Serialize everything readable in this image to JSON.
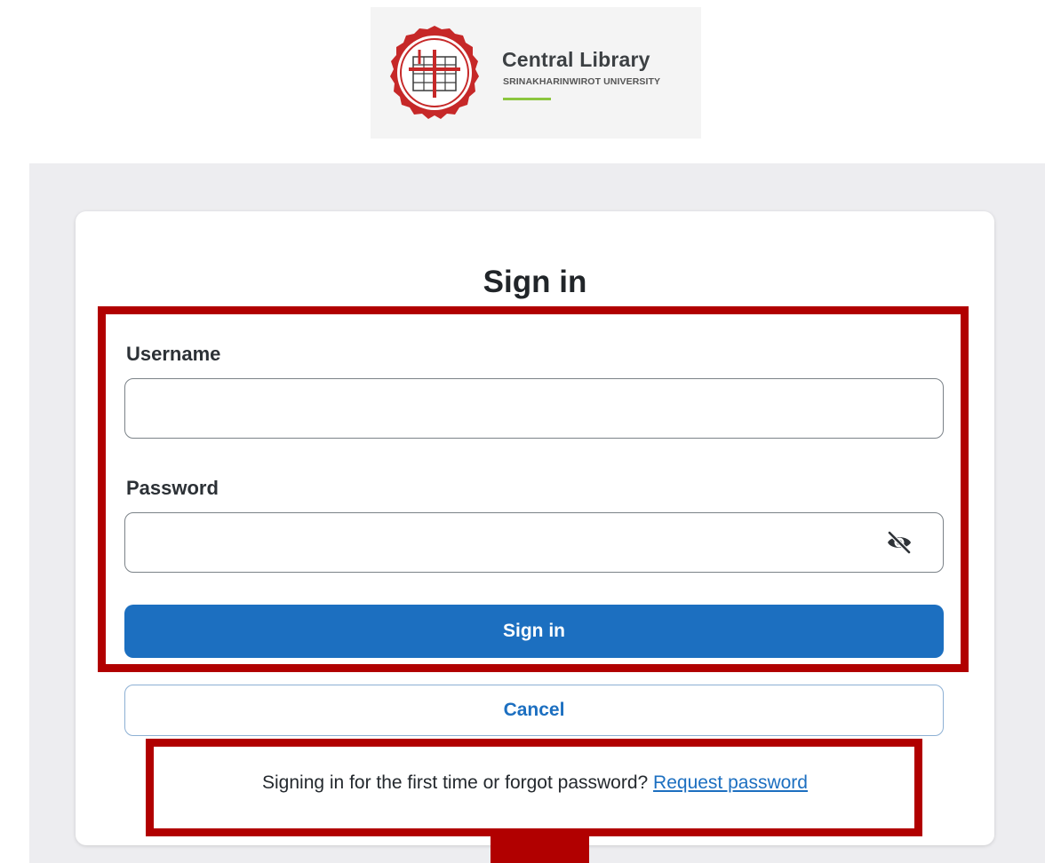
{
  "header": {
    "logo_title": "Central Library",
    "logo_subtitle": "SRINAKHARINWIROT UNIVERSITY"
  },
  "form": {
    "title": "Sign in",
    "username_label": "Username",
    "username_value": "",
    "password_label": "Password",
    "password_value": "",
    "submit_label": "Sign in",
    "cancel_label": "Cancel",
    "help_text": "Signing in for the first time or forgot password?",
    "help_link": "Request password"
  },
  "icons": {
    "seal": "university-seal-icon",
    "password_toggle": "eye-off-icon"
  },
  "colors": {
    "primary": "#1c6fc0",
    "highlight": "#b10000",
    "background": "#ededf0",
    "logo_accent": "#8cc63f"
  }
}
